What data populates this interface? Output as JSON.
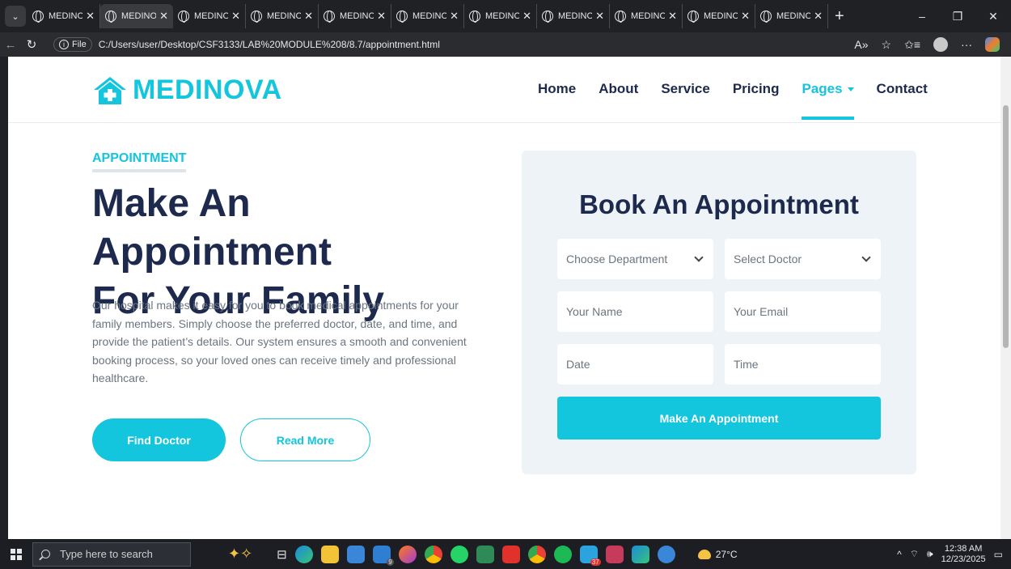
{
  "browser": {
    "tab_title": "MEDINOVA",
    "tab_count": 11,
    "url_label": "File",
    "url": "C:/Users/user/Desktop/CSF3133/LAB%20MODULE%208/8.7/appointment.html"
  },
  "site": {
    "brand": "MEDINOVA",
    "menu": [
      "Home",
      "About",
      "Service",
      "Pricing",
      "Pages",
      "Contact"
    ],
    "active_menu": "Pages"
  },
  "hero": {
    "eyebrow": "APPOINTMENT",
    "title_line1": "Make An Appointment",
    "title_line2": "For Your Family",
    "text": "Our hospital makes it easy for you to book medical appointments for your family members. Simply choose the preferred doctor, date, and time, and provide the patient’s details. Our system ensures a smooth and convenient booking process, so your loved ones can receive timely and professional healthcare.",
    "primary_button": "Find Doctor",
    "secondary_button": "Read More"
  },
  "booking": {
    "title": "Book An Appointment",
    "department_placeholder": "Choose Department",
    "doctor_placeholder": "Select Doctor",
    "name_placeholder": "Your Name",
    "email_placeholder": "Your Email",
    "date_placeholder": "Date",
    "time_placeholder": "Time",
    "submit_label": "Make An Appointment"
  },
  "taskbar": {
    "search_placeholder": "Type here to search",
    "weather": "27°C",
    "time": "12:38 AM",
    "date": "12/23/2025",
    "badge_mail": "9",
    "badge_telegram": "37"
  },
  "colors": {
    "accent": "#13c5dd",
    "heading": "#1d2a4d",
    "card_bg": "#eef3f8"
  }
}
